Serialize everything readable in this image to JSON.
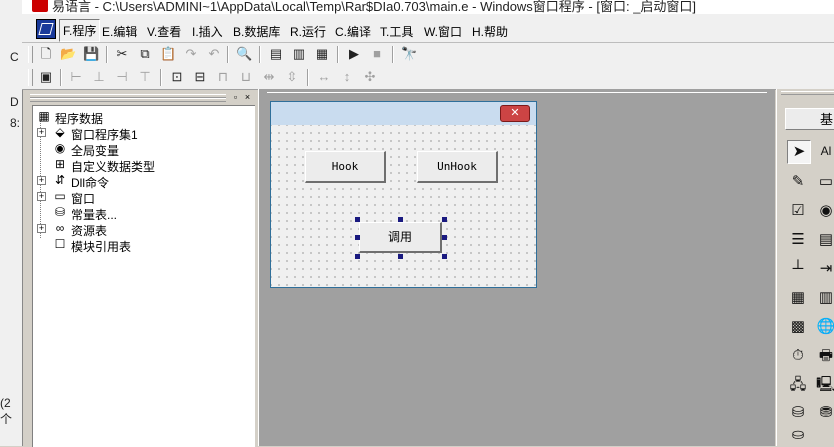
{
  "background_window": {
    "lines": [
      "C",
      "D",
      "8:",
      "(2 个"
    ]
  },
  "title": "易语言 - C:\\Users\\ADMINI~1\\AppData\\Local\\Temp\\Rar$DIa0.703\\main.e - Windows窗口程序 - [窗口: _启动窗口]",
  "menu": [
    {
      "label": "F.程序"
    },
    {
      "label": "E.编辑"
    },
    {
      "label": "V.查看"
    },
    {
      "label": "I.插入"
    },
    {
      "label": "B.数据库"
    },
    {
      "label": "R.运行"
    },
    {
      "label": "C.编译"
    },
    {
      "label": "T.工具"
    },
    {
      "label": "W.窗口"
    },
    {
      "label": "H.帮助"
    }
  ],
  "toolbar1": [
    {
      "icon": "new-file-icon",
      "glyph": "🗋"
    },
    {
      "icon": "open-folder-icon",
      "glyph": "📂"
    },
    {
      "icon": "save-icon",
      "glyph": "💾"
    },
    {
      "icon": "cut-icon",
      "glyph": "✂"
    },
    {
      "icon": "copy-icon",
      "glyph": "⧉"
    },
    {
      "icon": "paste-icon",
      "glyph": "📋"
    },
    {
      "icon": "redo-icon",
      "glyph": "↷"
    },
    {
      "icon": "undo-icon",
      "glyph": "↶"
    },
    {
      "icon": "find-icon",
      "glyph": "🔍"
    },
    {
      "icon": "layout-1-icon",
      "glyph": "▤"
    },
    {
      "icon": "layout-2-icon",
      "glyph": "▥"
    },
    {
      "icon": "layout-3-icon",
      "glyph": "▦"
    },
    {
      "icon": "run-icon",
      "glyph": "▶"
    },
    {
      "icon": "stop-icon",
      "glyph": "■"
    },
    {
      "icon": "debug-icon",
      "glyph": "🔭"
    }
  ],
  "toolbar2": [
    {
      "icon": "form-icon",
      "glyph": "▣"
    },
    {
      "icon": "align-left-icon",
      "glyph": "⊢"
    },
    {
      "icon": "align-center-icon",
      "glyph": "⊥"
    },
    {
      "icon": "align-right-icon",
      "glyph": "⊣"
    },
    {
      "icon": "align-top-icon",
      "glyph": "⊤"
    },
    {
      "icon": "center-h-icon",
      "glyph": "⊡"
    },
    {
      "icon": "center-v-icon",
      "glyph": "⊟"
    },
    {
      "icon": "same-width-icon",
      "glyph": "⊓"
    },
    {
      "icon": "same-height-icon",
      "glyph": "⊔"
    },
    {
      "icon": "space-h-icon",
      "glyph": "⇹"
    },
    {
      "icon": "space-v-icon",
      "glyph": "⇳"
    },
    {
      "icon": "size-h-icon",
      "glyph": "↔"
    },
    {
      "icon": "size-v-icon",
      "glyph": "↕"
    },
    {
      "icon": "grid-icon",
      "glyph": "✣"
    }
  ],
  "panel": {
    "pin": "▫",
    "close": "×"
  },
  "tree": [
    {
      "label": "程序数据",
      "icon": "program-data-icon",
      "glyph": "▦"
    },
    {
      "label": "窗口程序集1",
      "icon": "module-icon",
      "glyph": "⬙",
      "expander": "+"
    },
    {
      "label": "全局变量",
      "icon": "global-var-icon",
      "glyph": "◉"
    },
    {
      "label": "自定义数据类型",
      "icon": "data-type-icon",
      "glyph": "⊞"
    },
    {
      "label": "Dll命令",
      "icon": "dll-icon",
      "glyph": "⇵",
      "expander": "+"
    },
    {
      "label": "窗口",
      "icon": "window-icon",
      "glyph": "▭",
      "expander": "+"
    },
    {
      "label": "常量表...",
      "icon": "constants-icon",
      "glyph": "⛁"
    },
    {
      "label": "资源表",
      "icon": "resources-icon",
      "glyph": "∞",
      "expander": "+"
    },
    {
      "label": "模块引用表",
      "icon": "module-ref-icon",
      "glyph": "☐"
    }
  ],
  "form": {
    "close_glyph": "✕",
    "buttons": [
      {
        "label": "Hook"
      },
      {
        "label": "UnHook"
      },
      {
        "label": "调用"
      }
    ]
  },
  "right_panel": {
    "tab_label": "基",
    "tools": [
      {
        "icon": "pointer-icon",
        "glyph": "➤"
      },
      {
        "icon": "label-tool-icon",
        "glyph": "Al"
      },
      {
        "icon": "edit-tool-icon",
        "glyph": "✎"
      },
      {
        "icon": "image-box-icon",
        "glyph": "▭"
      },
      {
        "icon": "checkbox-tool-icon",
        "glyph": "☑"
      },
      {
        "icon": "radio-tool-icon",
        "glyph": "◉"
      },
      {
        "icon": "listbox-tool-icon",
        "glyph": "☰"
      },
      {
        "icon": "combo-tool-icon",
        "glyph": "▤"
      },
      {
        "icon": "ruler-tool-icon",
        "glyph": "┴"
      },
      {
        "icon": "scroll-tool-icon",
        "glyph": "⇥"
      },
      {
        "icon": "grid-tool-icon",
        "glyph": "▦"
      },
      {
        "icon": "table-tool-icon",
        "glyph": "▥"
      },
      {
        "icon": "chart-tool-icon",
        "glyph": "▩"
      },
      {
        "icon": "globe-tool-icon",
        "glyph": "🌐"
      },
      {
        "icon": "timer-tool-icon",
        "glyph": "⏱"
      },
      {
        "icon": "printer-tool-icon",
        "glyph": "🖶"
      },
      {
        "icon": "network-tool-icon",
        "glyph": "🖧"
      },
      {
        "icon": "server-tool-icon",
        "glyph": "🖳"
      },
      {
        "icon": "db-tool-icon",
        "glyph": "⛁"
      },
      {
        "icon": "db2-tool-icon",
        "glyph": "⛃"
      },
      {
        "icon": "db3-tool-icon",
        "glyph": "⛀"
      }
    ]
  }
}
